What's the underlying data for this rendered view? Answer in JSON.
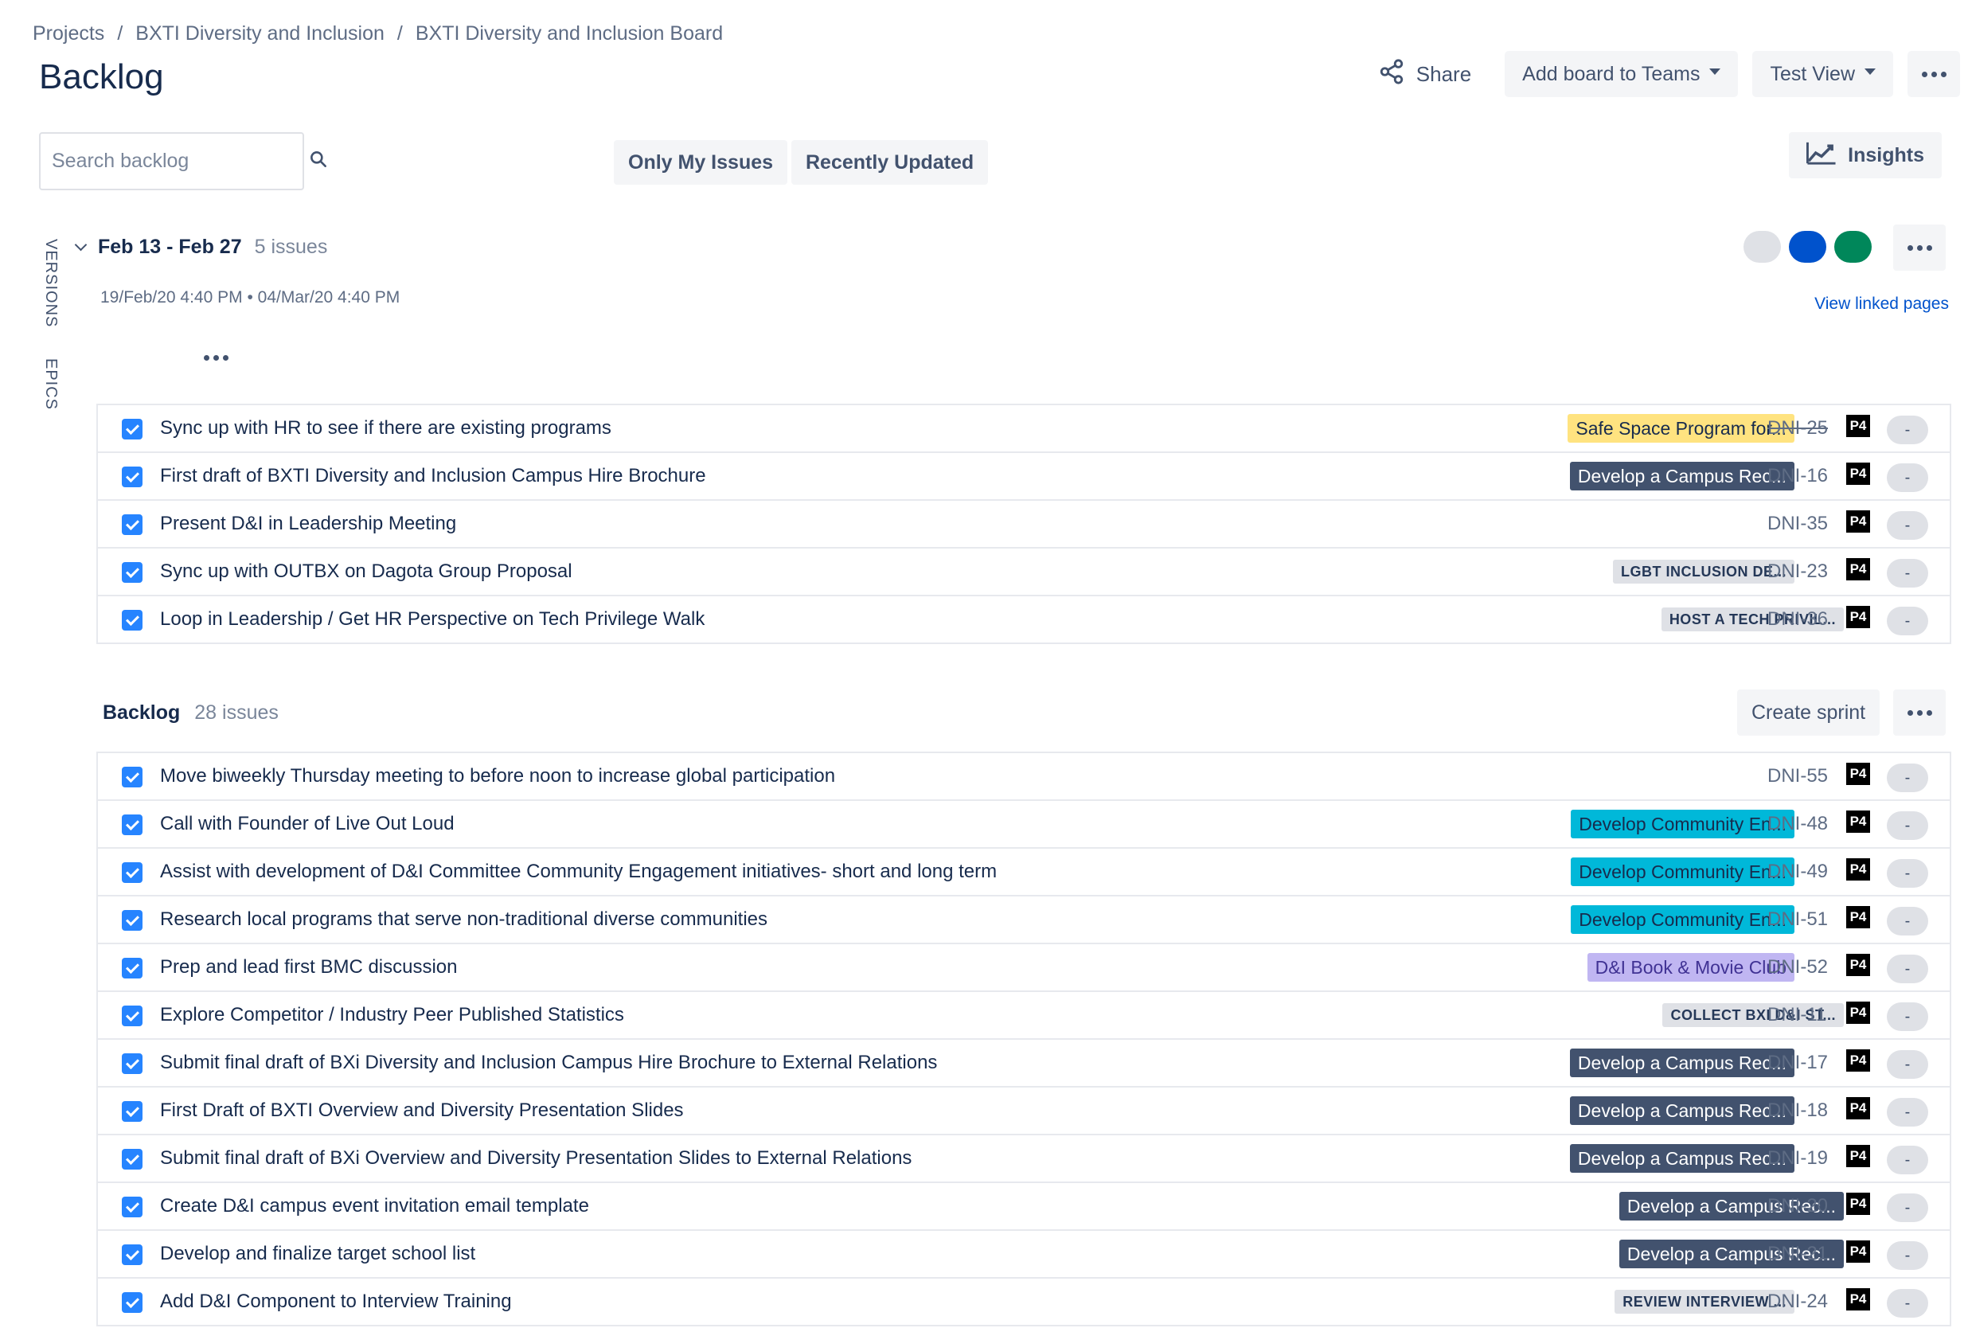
{
  "breadcrumb": [
    "Projects",
    "BXTI Diversity and Inclusion",
    "BXTI Diversity and Inclusion Board"
  ],
  "page_title": "Backlog",
  "header": {
    "share": "Share",
    "add_board": "Add board to Teams",
    "view": "Test View"
  },
  "search": {
    "placeholder": "Search backlog"
  },
  "filters": {
    "only_my_issues": "Only My Issues",
    "recently_updated": "Recently Updated"
  },
  "insights": "Insights",
  "side_tabs": {
    "versions": "VERSIONS",
    "epics": "EPICS"
  },
  "sprint": {
    "name": "Feb 13 - Feb 27",
    "count": "5 issues",
    "dates": "19/Feb/20 4:40 PM  •  04/Mar/20 4:40 PM",
    "view_linked": "View linked pages",
    "status_colors": [
      "#dfe1e6",
      "#0052cc",
      "#00875a"
    ],
    "issues": [
      {
        "summary": "Sync up with HR to see if there are existing programs",
        "epic": "Safe Space Program for...",
        "epic_style": "yellow",
        "key": "DNI-25",
        "done": true,
        "priority": "P4",
        "estimate": "-"
      },
      {
        "summary": "First draft of BXTI Diversity and Inclusion Campus Hire Brochure",
        "epic": "Develop a Campus Rec...",
        "epic_style": "dark",
        "key": "DNI-16",
        "done": false,
        "priority": "P4",
        "estimate": "-"
      },
      {
        "summary": "Present D&I in Leadership Meeting",
        "epic": "",
        "epic_style": "",
        "key": "DNI-35",
        "done": false,
        "priority": "P4",
        "estimate": "-"
      },
      {
        "summary": "Sync up with OUTBX on Dagota Group Proposal",
        "epic": "LGBT INCLUSION DE...",
        "epic_style": "grey",
        "key": "DNI-23",
        "done": false,
        "priority": "P4",
        "estimate": "-"
      },
      {
        "summary": "Loop in Leadership / Get HR Perspective on Tech Privilege Walk",
        "epic": "HOST A TECH PRIVIL...",
        "epic_style": "grey",
        "key": "DNI-36",
        "done": false,
        "priority": "P4",
        "estimate": "-"
      }
    ]
  },
  "backlog": {
    "name": "Backlog",
    "count": "28 issues",
    "create_sprint": "Create sprint",
    "issues": [
      {
        "summary": "Move biweekly Thursday meeting to before noon to increase global participation",
        "epic": "",
        "epic_style": "",
        "key": "DNI-55",
        "priority": "P4",
        "estimate": "-"
      },
      {
        "summary": "Call with Founder of Live Out Loud",
        "epic": "Develop Community En...",
        "epic_style": "teal",
        "key": "DNI-48",
        "priority": "P4",
        "estimate": "-"
      },
      {
        "summary": "Assist with development of D&I Committee Community Engagement initiatives- short and long term",
        "epic": "Develop Community En...",
        "epic_style": "teal",
        "key": "DNI-49",
        "priority": "P4",
        "estimate": "-"
      },
      {
        "summary": "Research local programs that serve non-traditional diverse communities",
        "epic": "Develop Community En...",
        "epic_style": "teal",
        "key": "DNI-51",
        "priority": "P4",
        "estimate": "-"
      },
      {
        "summary": "Prep and lead first BMC discussion",
        "epic": "D&I Book & Movie Club",
        "epic_style": "purple",
        "key": "DNI-52",
        "priority": "P4",
        "estimate": "-"
      },
      {
        "summary": "Explore Competitor / Industry Peer Published Statistics",
        "epic": "COLLECT BXI D&I ST...",
        "epic_style": "grey",
        "key": "DNI-11",
        "priority": "P4",
        "estimate": "-"
      },
      {
        "summary": "Submit final draft of BXi Diversity and Inclusion Campus Hire Brochure to External Relations",
        "epic": "Develop a Campus Rec...",
        "epic_style": "dark",
        "key": "DNI-17",
        "priority": "P4",
        "estimate": "-"
      },
      {
        "summary": "First Draft of BXTI Overview and Diversity Presentation Slides",
        "epic": "Develop a Campus Rec...",
        "epic_style": "dark",
        "key": "DNI-18",
        "priority": "P4",
        "estimate": "-"
      },
      {
        "summary": "Submit final draft of BXi Overview and Diversity Presentation Slides to External Relations",
        "epic": "Develop a Campus Rec...",
        "epic_style": "dark",
        "key": "DNI-19",
        "priority": "P4",
        "estimate": "-"
      },
      {
        "summary": "Create D&I campus event invitation email template",
        "epic": "Develop a Campus Rec...",
        "epic_style": "dark",
        "key": "DNI-20",
        "priority": "P4",
        "estimate": "-"
      },
      {
        "summary": "Develop and finalize target school list",
        "epic": "Develop a Campus Rec...",
        "epic_style": "dark",
        "key": "DNI-21",
        "priority": "P4",
        "estimate": "-"
      },
      {
        "summary": "Add D&I Component to Interview Training",
        "epic": "REVIEW INTERVIEW ...",
        "epic_style": "grey",
        "key": "DNI-24",
        "priority": "P4",
        "estimate": "-"
      }
    ]
  }
}
